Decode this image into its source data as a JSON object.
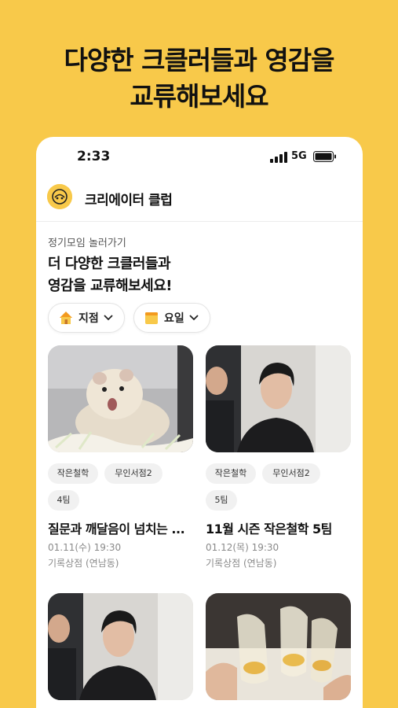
{
  "headline": {
    "line1": "다양한 크클러들과 영감을",
    "line2": "교류해보세요"
  },
  "status_bar": {
    "time": "2:33",
    "network": "5G"
  },
  "app": {
    "title": "크리에이터 클럽"
  },
  "section": {
    "label": "정기모임 놀러가기",
    "title_line1": "더 다양한 크클러들과",
    "title_line2": "영감을 교류해보세요!"
  },
  "filters": [
    {
      "label": "지점",
      "icon": "house-icon"
    },
    {
      "label": "요일",
      "icon": "calendar-icon"
    }
  ],
  "cards": [
    {
      "tags": [
        "작은철학",
        "무인서점2",
        "4팀"
      ],
      "title": "질문과 깨달음이 넘치는 ...",
      "date": "01.11(수) 19:30",
      "place": "기록상점 (연남동)",
      "image": "hamster-photo"
    },
    {
      "tags": [
        "작은철학",
        "무인서점2",
        "5팀"
      ],
      "title": "11월 시즌 작은철학 5팀",
      "date": "01.12(목) 19:30",
      "place": "기록상점 (연남동)",
      "image": "people-photo"
    },
    {
      "image": "people-photo"
    },
    {
      "image": "toast-glasses-photo"
    }
  ],
  "colors": {
    "brand": "#F8C94A",
    "text": "#111111",
    "muted": "#8a8a8a",
    "tag_bg": "#f1f1f1"
  }
}
